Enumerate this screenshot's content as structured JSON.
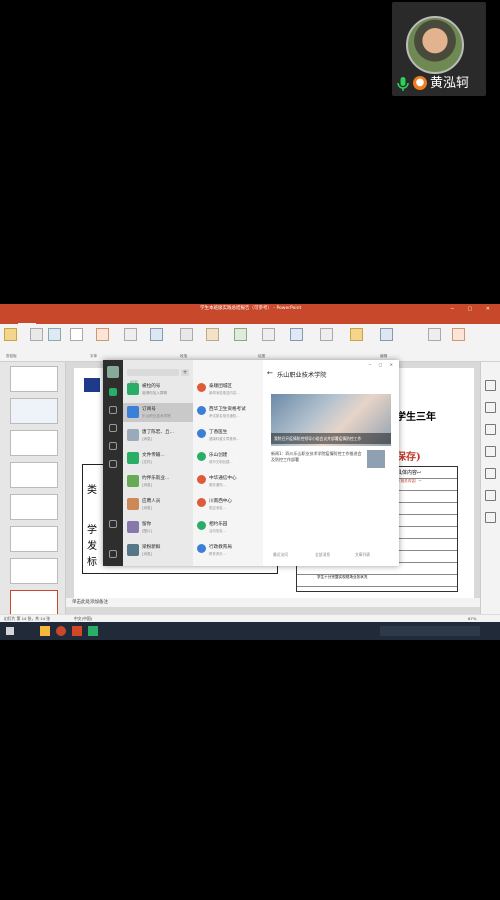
{
  "participant": {
    "name": "黄泓轲",
    "mic_icon": "microphone-icon",
    "person_icon": "person-icon"
  },
  "powerpoint": {
    "window_title": "学生本班级实践总结报告（可参考） - PowerPoint",
    "tabs": [
      "文件",
      "开始",
      "插入",
      "设计",
      "切换",
      "动画",
      "幻灯片放映",
      "审阅",
      "视图",
      "帮助",
      "告诉我你想做什么"
    ],
    "active_tab": "开始",
    "ribbon_groups": [
      "剪贴板",
      "字体",
      "段落",
      "绘图",
      "编辑"
    ],
    "slide_text": {
      "heading_right": "学生三年",
      "save_label": "保存)",
      "table_header": "具体内容↩",
      "table_sub": "（相关内容）↩",
      "left_col": [
        "类",
        "学",
        "发",
        "标"
      ],
      "footer_cell": "学生十分完整实现现场业务状况"
    },
    "notes_placeholder": "单击此处添加备注",
    "status_left": "幻灯片 第 14 张，共 14 张",
    "status_lang": "中文(中国)",
    "zoom": "67%"
  },
  "wechat": {
    "search_placeholder": "搜索",
    "chats": [
      {
        "name": "被拉的号",
        "msg": "邀请你加入群聊",
        "color": "#2aae67"
      },
      {
        "name": "订阅号",
        "msg": "乐山职业技术学院",
        "color": "#3b7fd9"
      },
      {
        "name": "唐丁陈宏、丘...",
        "msg": "[消息]",
        "color": "#9ab"
      },
      {
        "name": "文件传输...",
        "msg": "[文件]",
        "color": "#2aae67"
      },
      {
        "name": "约伴乐就业...",
        "msg": "[消息]",
        "color": "#6a5"
      },
      {
        "name": "应聘人员",
        "msg": "[消息]",
        "color": "#c85"
      },
      {
        "name": "留你",
        "msg": "[图片]",
        "color": "#87a"
      },
      {
        "name": "梁粉新鲜",
        "msg": "[消息]",
        "color": "#578"
      }
    ],
    "list": [
      {
        "name": "泰顺团城区",
        "msg": "新闻消息推送内容...",
        "color": "#e05a3a"
      },
      {
        "name": "西华卫生资格考试",
        "msg": "考试报名相关通知...",
        "color": "#3b7fd9"
      },
      {
        "name": "丁香医生",
        "msg": "健康科普文章推荐...",
        "color": "#3b7fd9"
      },
      {
        "name": "乐山创建",
        "msg": "城市文明创建...",
        "color": "#2aae67"
      },
      {
        "name": "中华通信中心",
        "msg": "服务通知...",
        "color": "#e05a3a"
      },
      {
        "name": "川南西中心",
        "msg": "推送消息...",
        "color": "#e05a3a"
      },
      {
        "name": "相约乐园",
        "msg": "活动信息...",
        "color": "#2aae67"
      },
      {
        "name": "行政教育局",
        "msg": "教育资讯...",
        "color": "#3b7fd9"
      }
    ],
    "article": {
      "title": "乐山职业技术学院",
      "caption": "我院召开疫情防控领导小组会议并部署疫情防控工作",
      "desc": "新闻1：四川乐山职业技术学院疫情防控工作推进会 及防控工作部署",
      "footer": [
        "最近访问",
        "全部消息",
        "文章列表"
      ]
    }
  },
  "colors": {
    "ppt_red": "#c8482b",
    "wechat_green": "#2aae67"
  }
}
